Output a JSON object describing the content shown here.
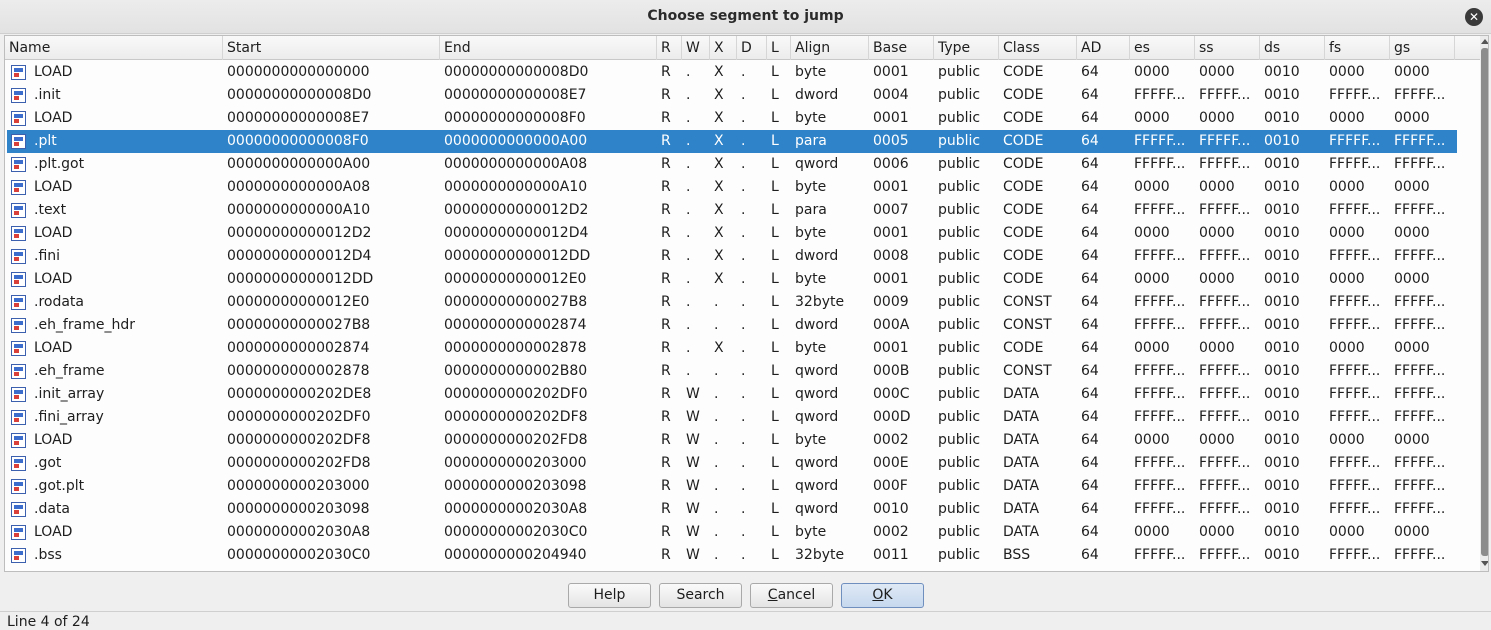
{
  "window": {
    "title": "Choose segment to jump",
    "close_icon": "close-icon"
  },
  "table": {
    "columns": [
      "Name",
      "Start",
      "End",
      "R",
      "W",
      "X",
      "D",
      "L",
      "Align",
      "Base",
      "Type",
      "Class",
      "AD",
      "es",
      "ss",
      "ds",
      "fs",
      "gs"
    ],
    "selected_index": 3,
    "rows": [
      [
        "LOAD",
        "0000000000000000",
        "00000000000008D0",
        "R",
        ".",
        "X",
        ".",
        "L",
        "byte",
        "0001",
        "public",
        "CODE",
        "64",
        "0000",
        "0000",
        "0010",
        "0000",
        "0000"
      ],
      [
        ".init",
        "00000000000008D0",
        "00000000000008E7",
        "R",
        ".",
        "X",
        ".",
        "L",
        "dword",
        "0004",
        "public",
        "CODE",
        "64",
        "FFFFF...",
        "FFFFF...",
        "0010",
        "FFFFF...",
        "FFFFF..."
      ],
      [
        "LOAD",
        "00000000000008E7",
        "00000000000008F0",
        "R",
        ".",
        "X",
        ".",
        "L",
        "byte",
        "0001",
        "public",
        "CODE",
        "64",
        "0000",
        "0000",
        "0010",
        "0000",
        "0000"
      ],
      [
        ".plt",
        "00000000000008F0",
        "0000000000000A00",
        "R",
        ".",
        "X",
        ".",
        "L",
        "para",
        "0005",
        "public",
        "CODE",
        "64",
        "FFFFF...",
        "FFFFF...",
        "0010",
        "FFFFF...",
        "FFFFF..."
      ],
      [
        ".plt.got",
        "0000000000000A00",
        "0000000000000A08",
        "R",
        ".",
        "X",
        ".",
        "L",
        "qword",
        "0006",
        "public",
        "CODE",
        "64",
        "FFFFF...",
        "FFFFF...",
        "0010",
        "FFFFF...",
        "FFFFF..."
      ],
      [
        "LOAD",
        "0000000000000A08",
        "0000000000000A10",
        "R",
        ".",
        "X",
        ".",
        "L",
        "byte",
        "0001",
        "public",
        "CODE",
        "64",
        "0000",
        "0000",
        "0010",
        "0000",
        "0000"
      ],
      [
        ".text",
        "0000000000000A10",
        "00000000000012D2",
        "R",
        ".",
        "X",
        ".",
        "L",
        "para",
        "0007",
        "public",
        "CODE",
        "64",
        "FFFFF...",
        "FFFFF...",
        "0010",
        "FFFFF...",
        "FFFFF..."
      ],
      [
        "LOAD",
        "00000000000012D2",
        "00000000000012D4",
        "R",
        ".",
        "X",
        ".",
        "L",
        "byte",
        "0001",
        "public",
        "CODE",
        "64",
        "0000",
        "0000",
        "0010",
        "0000",
        "0000"
      ],
      [
        ".fini",
        "00000000000012D4",
        "00000000000012DD",
        "R",
        ".",
        "X",
        ".",
        "L",
        "dword",
        "0008",
        "public",
        "CODE",
        "64",
        "FFFFF...",
        "FFFFF...",
        "0010",
        "FFFFF...",
        "FFFFF..."
      ],
      [
        "LOAD",
        "00000000000012DD",
        "00000000000012E0",
        "R",
        ".",
        "X",
        ".",
        "L",
        "byte",
        "0001",
        "public",
        "CODE",
        "64",
        "0000",
        "0000",
        "0010",
        "0000",
        "0000"
      ],
      [
        ".rodata",
        "00000000000012E0",
        "00000000000027B8",
        "R",
        ".",
        ".",
        ".",
        "L",
        "32byte",
        "0009",
        "public",
        "CONST",
        "64",
        "FFFFF...",
        "FFFFF...",
        "0010",
        "FFFFF...",
        "FFFFF..."
      ],
      [
        ".eh_frame_hdr",
        "00000000000027B8",
        "0000000000002874",
        "R",
        ".",
        ".",
        ".",
        "L",
        "dword",
        "000A",
        "public",
        "CONST",
        "64",
        "FFFFF...",
        "FFFFF...",
        "0010",
        "FFFFF...",
        "FFFFF..."
      ],
      [
        "LOAD",
        "0000000000002874",
        "0000000000002878",
        "R",
        ".",
        "X",
        ".",
        "L",
        "byte",
        "0001",
        "public",
        "CODE",
        "64",
        "0000",
        "0000",
        "0010",
        "0000",
        "0000"
      ],
      [
        ".eh_frame",
        "0000000000002878",
        "0000000000002B80",
        "R",
        ".",
        ".",
        ".",
        "L",
        "qword",
        "000B",
        "public",
        "CONST",
        "64",
        "FFFFF...",
        "FFFFF...",
        "0010",
        "FFFFF...",
        "FFFFF..."
      ],
      [
        ".init_array",
        "0000000000202DE8",
        "0000000000202DF0",
        "R",
        "W",
        ".",
        ".",
        "L",
        "qword",
        "000C",
        "public",
        "DATA",
        "64",
        "FFFFF...",
        "FFFFF...",
        "0010",
        "FFFFF...",
        "FFFFF..."
      ],
      [
        ".fini_array",
        "0000000000202DF0",
        "0000000000202DF8",
        "R",
        "W",
        ".",
        ".",
        "L",
        "qword",
        "000D",
        "public",
        "DATA",
        "64",
        "FFFFF...",
        "FFFFF...",
        "0010",
        "FFFFF...",
        "FFFFF..."
      ],
      [
        "LOAD",
        "0000000000202DF8",
        "0000000000202FD8",
        "R",
        "W",
        ".",
        ".",
        "L",
        "byte",
        "0002",
        "public",
        "DATA",
        "64",
        "0000",
        "0000",
        "0010",
        "0000",
        "0000"
      ],
      [
        ".got",
        "0000000000202FD8",
        "0000000000203000",
        "R",
        "W",
        ".",
        ".",
        "L",
        "qword",
        "000E",
        "public",
        "DATA",
        "64",
        "FFFFF...",
        "FFFFF...",
        "0010",
        "FFFFF...",
        "FFFFF..."
      ],
      [
        ".got.plt",
        "0000000000203000",
        "0000000000203098",
        "R",
        "W",
        ".",
        ".",
        "L",
        "qword",
        "000F",
        "public",
        "DATA",
        "64",
        "FFFFF...",
        "FFFFF...",
        "0010",
        "FFFFF...",
        "FFFFF..."
      ],
      [
        ".data",
        "0000000000203098",
        "00000000002030A8",
        "R",
        "W",
        ".",
        ".",
        "L",
        "qword",
        "0010",
        "public",
        "DATA",
        "64",
        "FFFFF...",
        "FFFFF...",
        "0010",
        "FFFFF...",
        "FFFFF..."
      ],
      [
        "LOAD",
        "00000000002030A8",
        "00000000002030C0",
        "R",
        "W",
        ".",
        ".",
        "L",
        "byte",
        "0002",
        "public",
        "DATA",
        "64",
        "0000",
        "0000",
        "0010",
        "0000",
        "0000"
      ],
      [
        ".bss",
        "00000000002030C0",
        "0000000000204940",
        "R",
        "W",
        ".",
        ".",
        "L",
        "32byte",
        "0011",
        "public",
        "BSS",
        "64",
        "FFFFF...",
        "FFFFF...",
        "0010",
        "FFFFF...",
        "FFFFF..."
      ]
    ]
  },
  "buttons": {
    "help": "Help",
    "search": "Search",
    "cancel": "Cancel",
    "ok": "OK"
  },
  "status": {
    "text": "Line 4 of 24"
  },
  "colors": {
    "selection": "#2f83c8"
  }
}
